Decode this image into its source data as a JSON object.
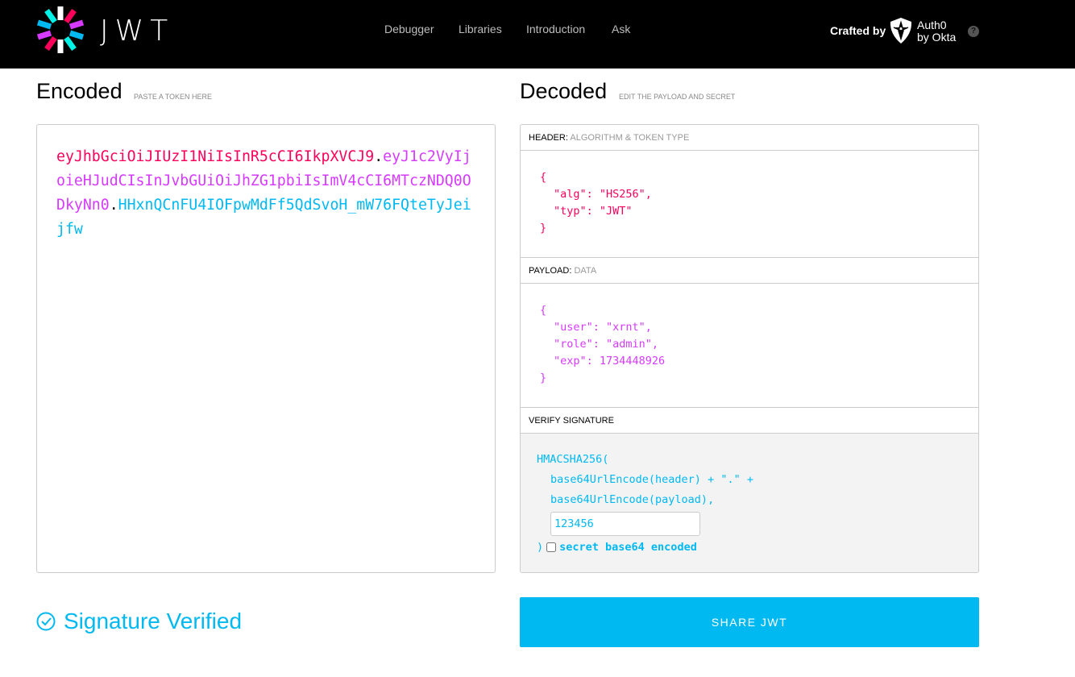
{
  "nav": {
    "logo_text": "JWT",
    "items": [
      "Debugger",
      "Libraries",
      "Introduction",
      "Ask"
    ],
    "crafted_by": "Crafted by",
    "brand_line1": "Auth0",
    "brand_line2": "by Okta",
    "help": "?"
  },
  "encoded": {
    "title": "Encoded",
    "subtitle": "PASTE A TOKEN HERE",
    "header_part": "eyJhbGciOiJIUzI1NiIsInR5cCI6IkpXVCJ9",
    "payload_part": "eyJ1c2VyIjoieHJudCIsInJvbGUiOiJhZG1pbiIsImV4cCI6MTczNDQ0ODkyNn0",
    "signature_part": "HHxnQCnFU4IOFpwMdFf5QdSvoH_mW76FQteTyJeijfw",
    "dot": "."
  },
  "decoded": {
    "title": "Decoded",
    "subtitle": "EDIT THE PAYLOAD AND SECRET",
    "header": {
      "label": "HEADER:",
      "sublabel": "ALGORITHM & TOKEN TYPE",
      "open": "{",
      "lines": [
        "\"alg\": \"HS256\",",
        "\"typ\": \"JWT\""
      ],
      "close": "}"
    },
    "payload": {
      "label": "PAYLOAD:",
      "sublabel": "DATA",
      "open": "{",
      "lines": [
        "\"user\": \"xrnt\",",
        "\"role\": \"admin\",",
        "\"exp\": 1734448926"
      ],
      "close": "}"
    },
    "verify": {
      "label": "VERIFY SIGNATURE",
      "fn": "HMACSHA256(",
      "line1": "base64UrlEncode(header) + \".\" +",
      "line2": "base64UrlEncode(payload),",
      "secret": "123456",
      "close": ")",
      "checkbox_label": "secret base64 encoded",
      "checked": false
    }
  },
  "status": {
    "text": "Signature Verified"
  },
  "share_label": "SHARE JWT",
  "colors": {
    "header": "#fb015b",
    "payload": "#d63aff",
    "signature": "#00b9f1"
  }
}
